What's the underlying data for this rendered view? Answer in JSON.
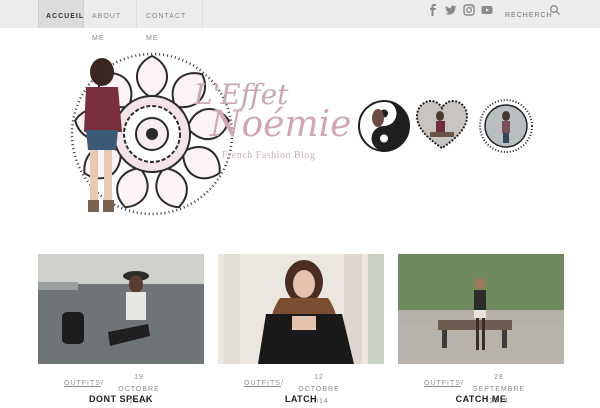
{
  "nav": {
    "home": "Accueil",
    "about": "About me",
    "contact": "Contact me"
  },
  "social_icons": [
    "facebook-icon",
    "twitter-icon",
    "instagram-icon",
    "youtube-icon"
  ],
  "search": {
    "placeholder": "Recherche"
  },
  "header": {
    "title_line1": "L'Effet",
    "title_line2": "Noémie",
    "subtitle": "French Fashion Blog"
  },
  "posts": [
    {
      "category": "Outfits",
      "date_line1": "19 Octobre",
      "date_line2": "2014",
      "title": "Dont speak"
    },
    {
      "category": "Outfits",
      "date_line1": "12 Octobre",
      "date_line2": "2014",
      "title": "Latch"
    },
    {
      "category": "Outfits",
      "date_line1": "28 Septembre",
      "date_line2": "2014",
      "title": "Catch me"
    }
  ],
  "colors": {
    "accent": "#c9a7b0",
    "nav_bg": "#ececec"
  }
}
